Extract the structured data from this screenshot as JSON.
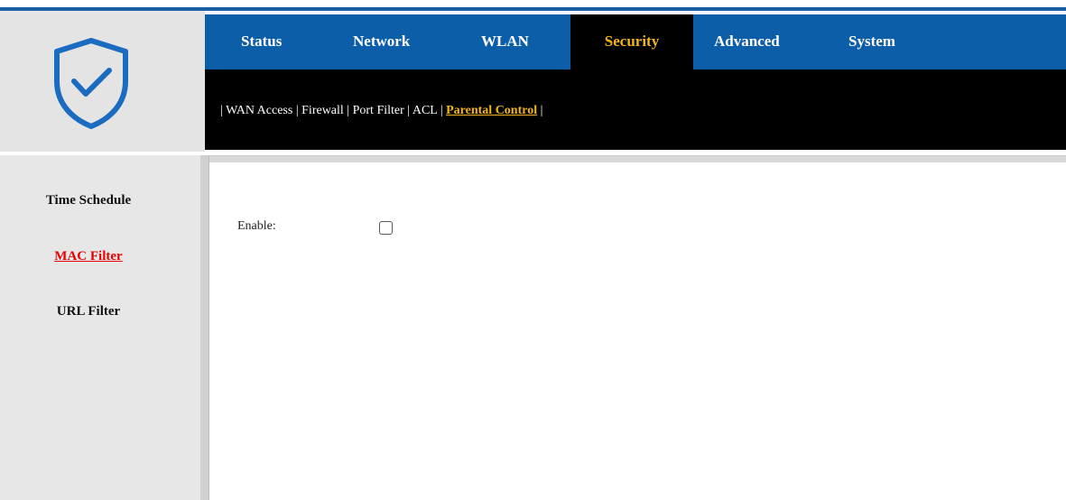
{
  "header": {
    "nav_tabs": [
      {
        "label": "Status",
        "active": false
      },
      {
        "label": "Network",
        "active": false
      },
      {
        "label": "WLAN",
        "active": false
      },
      {
        "label": "Security",
        "active": true
      },
      {
        "label": "Advanced",
        "active": false
      },
      {
        "label": "System",
        "active": false
      }
    ],
    "sub_nav": [
      {
        "label": "WAN Access",
        "active": false
      },
      {
        "label": "Firewall",
        "active": false
      },
      {
        "label": "Port Filter",
        "active": false
      },
      {
        "label": "ACL",
        "active": false
      },
      {
        "label": "Parental Control",
        "active": true
      }
    ],
    "separator": "|"
  },
  "logo": {
    "icon": "shield-check-icon"
  },
  "sidebar": {
    "items": [
      {
        "label": "Time Schedule",
        "active": false
      },
      {
        "label": "MAC Filter",
        "active": true
      },
      {
        "label": "URL Filter",
        "active": false
      }
    ]
  },
  "main": {
    "enable_label": "Enable:",
    "enable_checked": false
  },
  "colors": {
    "brand_blue": "#0d5ea8",
    "active_tab_text": "#f2b51b",
    "active_sidebar_text": "#e60000",
    "header_black": "#000000",
    "sidebar_gray": "#e7e7e7"
  }
}
